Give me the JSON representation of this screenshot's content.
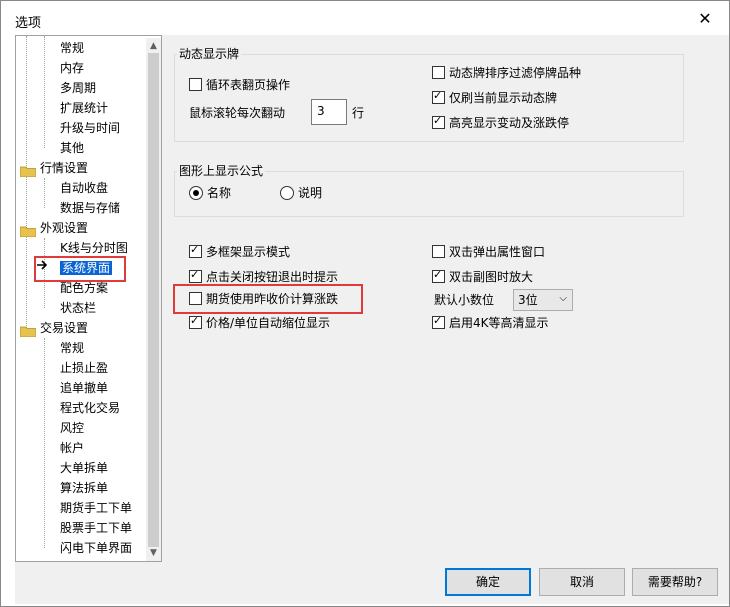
{
  "window": {
    "title": "选项",
    "close_glyph": "✕"
  },
  "tree": {
    "items": [
      {
        "label": "常规",
        "level": 2
      },
      {
        "label": "内存",
        "level": 2
      },
      {
        "label": "多周期",
        "level": 2
      },
      {
        "label": "扩展统计",
        "level": 2
      },
      {
        "label": "升级与时间",
        "level": 2
      },
      {
        "label": "其他",
        "level": 2
      },
      {
        "label": "行情设置",
        "level": 1
      },
      {
        "label": "自动收盘",
        "level": 2
      },
      {
        "label": "数据与存储",
        "level": 2
      },
      {
        "label": "外观设置",
        "level": 1
      },
      {
        "label": "K线与分时图",
        "level": 2
      },
      {
        "label": "系统界面",
        "level": 2,
        "selected": true
      },
      {
        "label": "配色方案",
        "level": 2
      },
      {
        "label": "状态栏",
        "level": 2
      },
      {
        "label": "交易设置",
        "level": 1
      },
      {
        "label": "常规",
        "level": 2
      },
      {
        "label": "止损止盈",
        "level": 2
      },
      {
        "label": "追单撤单",
        "level": 2
      },
      {
        "label": "程式化交易",
        "level": 2
      },
      {
        "label": "风控",
        "level": 2
      },
      {
        "label": "帐户",
        "level": 2
      },
      {
        "label": "大单拆单",
        "level": 2
      },
      {
        "label": "算法拆单",
        "level": 2
      },
      {
        "label": "期货手工下单",
        "level": 2
      },
      {
        "label": "股票手工下单",
        "level": 2
      },
      {
        "label": "闪电下单界面",
        "level": 2
      }
    ]
  },
  "dynamic_board": {
    "title": "动态显示牌",
    "cycle_page": {
      "label": "循环表翻页操作",
      "checked": false
    },
    "scroll_label": "鼠标滚轮每次翻动",
    "scroll_value": "3",
    "scroll_unit": "行",
    "filter_suspended": {
      "label": "动态牌排序过滤停牌品种",
      "checked": false
    },
    "refresh_current": {
      "label": "仅刷当前显示动态牌",
      "checked": true
    },
    "highlight_change": {
      "label": "高亮显示变动及涨跌停",
      "checked": true
    }
  },
  "formula_display": {
    "title": "图形上显示公式",
    "options": [
      {
        "label": "名称",
        "selected": true
      },
      {
        "label": "说明",
        "selected": false
      }
    ]
  },
  "options": {
    "multi_frame": {
      "label": "多框架显示模式",
      "checked": true
    },
    "close_prompt": {
      "label": "点击关闭按钮退出时提示",
      "checked": true
    },
    "futures_prev_close": {
      "label": "期货使用昨收价计算涨跌",
      "checked": false
    },
    "auto_scale": {
      "label": "价格/单位自动缩位显示",
      "checked": true
    },
    "dblclick_popup": {
      "label": "双击弹出属性窗口",
      "checked": false
    },
    "dblclick_zoom": {
      "label": "双击副图时放大",
      "checked": true
    },
    "decimal_label": "默认小数位",
    "decimal_value": "3位",
    "hd_4k": {
      "label": "启用4K等高清显示",
      "checked": true
    }
  },
  "buttons": {
    "ok": "确定",
    "cancel": "取消",
    "help": "需要帮助?"
  },
  "colors": {
    "selection": "#0a64d2",
    "highlight_box": "#e03a3a",
    "accent_border": "#0078d7"
  }
}
